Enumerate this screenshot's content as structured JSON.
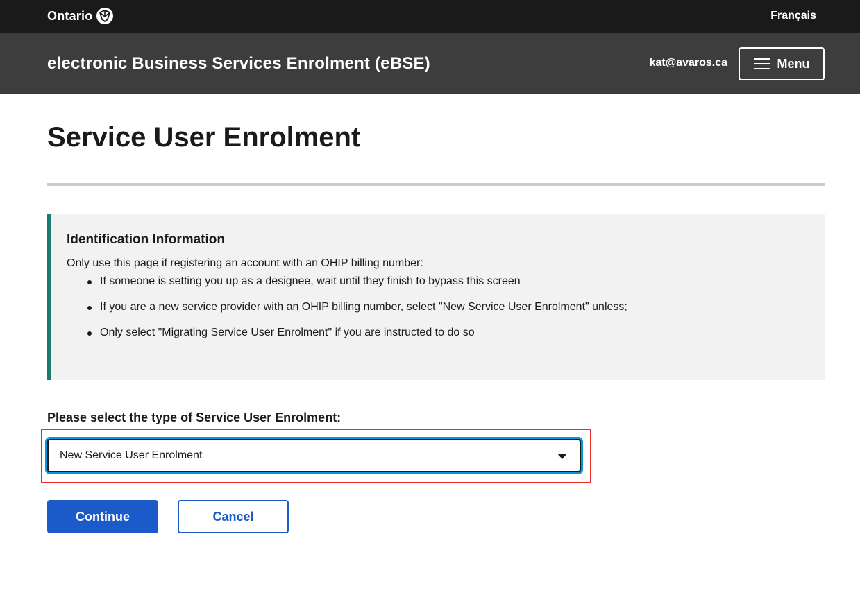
{
  "topbar": {
    "logo_text": "Ontario",
    "logo_icon": "trillium-icon",
    "language_link": "Français"
  },
  "header": {
    "app_title": "electronic Business Services Enrolment (eBSE)",
    "user_email": "kat@avaros.ca",
    "menu_label": "Menu",
    "menu_icon": "hamburger-icon"
  },
  "main": {
    "page_title": "Service User Enrolment",
    "callout": {
      "heading": "Identification Information",
      "intro": "Only use this page if registering an account with an OHIP billing number:",
      "items": [
        "If someone is setting you up as a designee, wait until they finish to bypass this screen",
        "If you are a new service provider with an OHIP billing number, select \"New Service User Enrolment\" unless;",
        "Only select \"Migrating Service User Enrolment\" if you are instructed to do so"
      ]
    },
    "select": {
      "label": "Please select the type of Service User Enrolment:",
      "value": "New Service User Enrolment"
    },
    "buttons": {
      "continue": "Continue",
      "cancel": "Cancel"
    }
  },
  "colors": {
    "topbar_bg": "#1a1a1a",
    "appbar_bg": "#3d3d3d",
    "primary_blue": "#1a5ac9",
    "callout_accent": "#1d7a6e",
    "focus_ring": "#009adb",
    "highlight_red": "#ee2a24"
  }
}
